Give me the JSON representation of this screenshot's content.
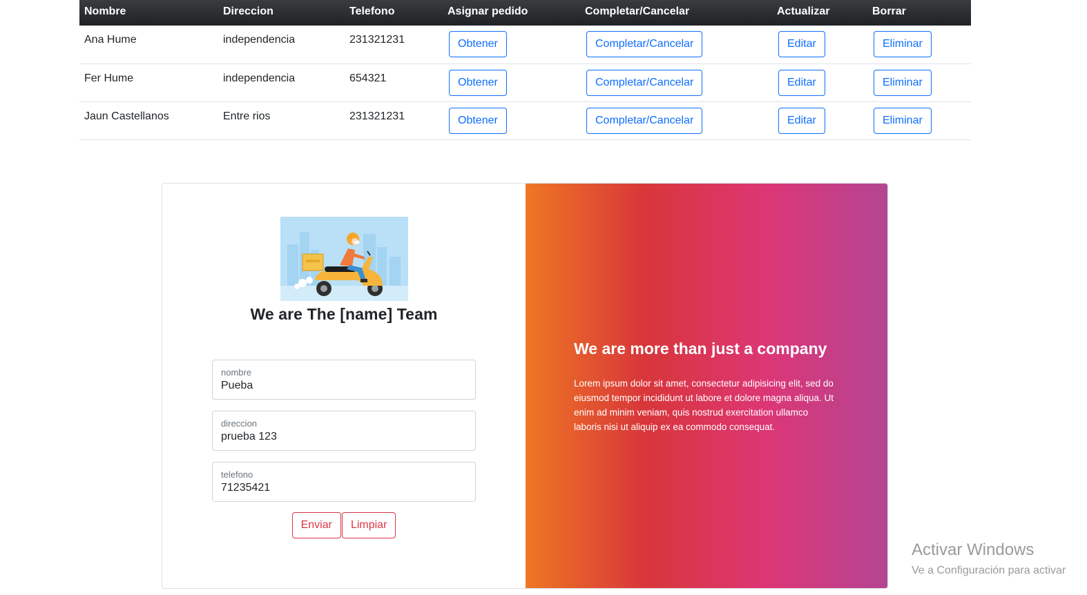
{
  "table": {
    "headers": [
      "Nombre",
      "Direccion",
      "Telefono",
      "Asignar pedido",
      "Completar/Cancelar",
      "Actualizar",
      "Borrar"
    ],
    "rows": [
      {
        "nombre": "Ana Hume",
        "direccion": "independencia",
        "telefono": "231321231"
      },
      {
        "nombre": "Fer Hume",
        "direccion": "independencia",
        "telefono": "654321"
      },
      {
        "nombre": "Jaun Castellanos",
        "direccion": "Entre rios",
        "telefono": "231321231"
      }
    ],
    "actions": {
      "obtener": "Obtener",
      "completar": "Completar/Cancelar",
      "editar": "Editar",
      "eliminar": "Eliminar"
    }
  },
  "form": {
    "title": "We are The [name] Team",
    "illustration": "delivery-scooter-illustration",
    "fields": {
      "nombre": {
        "label": "nombre",
        "value": "Pueba"
      },
      "direccion": {
        "label": "direccion",
        "value": "prueba 123"
      },
      "telefono": {
        "label": "telefono",
        "value": "71235421"
      }
    },
    "submit_label": "Enviar",
    "reset_label": "Limpiar"
  },
  "promo": {
    "title": "We are more than just a company",
    "text": "Lorem ipsum dolor sit amet, consectetur adipisicing elit, sed do eiusmod tempor incididunt ut labore et dolore magna aliqua. Ut enim ad minim veniam, quis nostrud exercitation ullamco laboris nisi ut aliquip ex ea commodo consequat.",
    "gradient": [
      "#ee7724",
      "#d8363a",
      "#dd3675",
      "#b44593"
    ]
  },
  "watermark": {
    "title": "Activar Windows",
    "subtitle": "Ve a Configuración para activar"
  },
  "colors": {
    "primary": "#0d6efd",
    "danger": "#dc3545",
    "header_bg": "#212529"
  }
}
